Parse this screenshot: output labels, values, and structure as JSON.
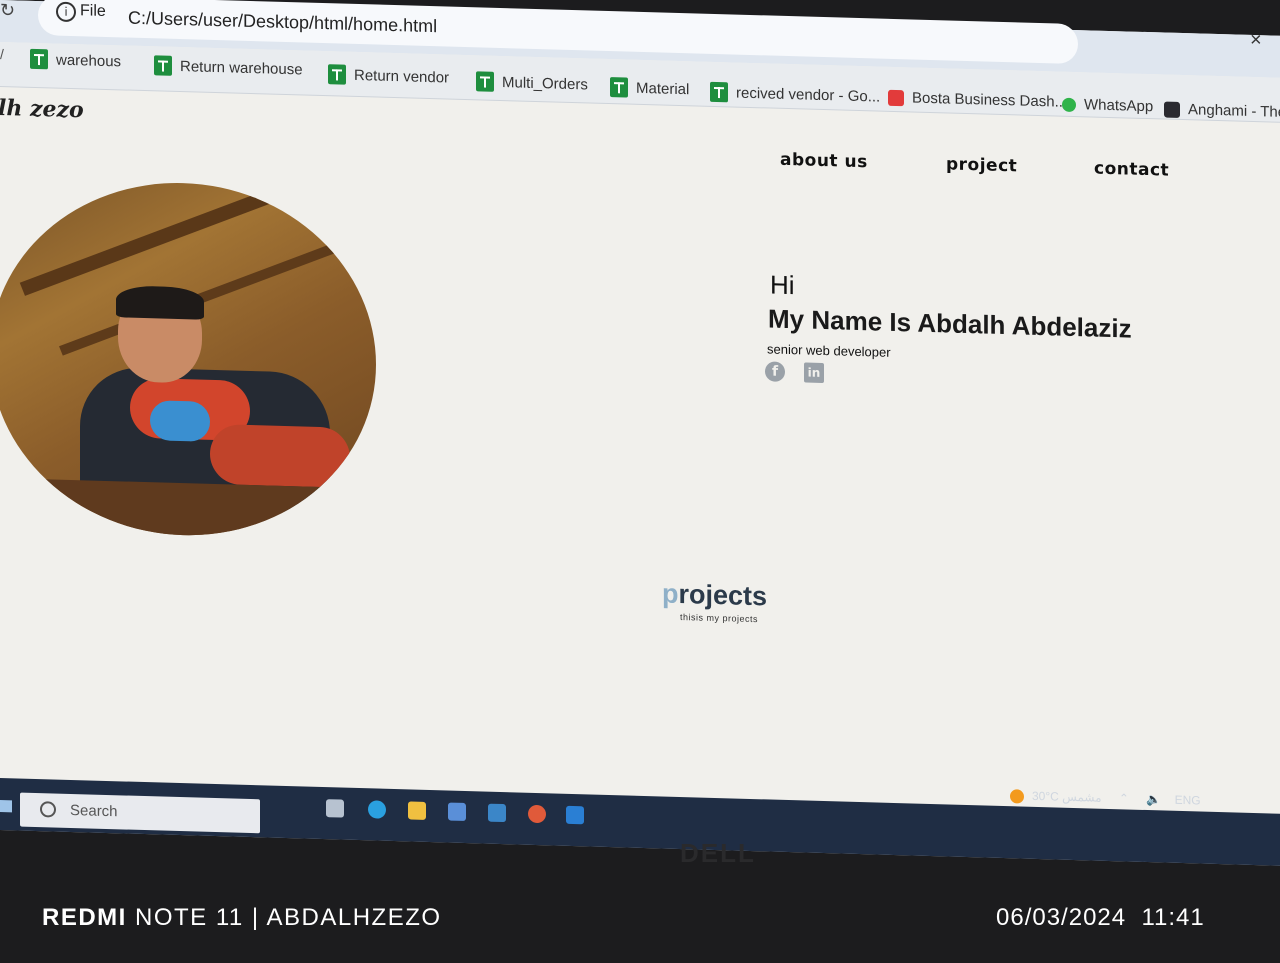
{
  "browser": {
    "file_label": "File",
    "url": "C:/Users/user/Desktop/html/home.html"
  },
  "bookmarks": [
    {
      "label": "warehous",
      "icon": "sheets-icon"
    },
    {
      "label": "Return warehouse",
      "icon": "sheets-icon"
    },
    {
      "label": "Return vendor",
      "icon": "sheets-icon"
    },
    {
      "label": "Multi_Orders",
      "icon": "sheets-icon"
    },
    {
      "label": "Material",
      "icon": "sheets-icon"
    },
    {
      "label": "recived vendor - Go...",
      "icon": "sheets-icon"
    },
    {
      "label": "Bosta Business Dash...",
      "icon": "bosta-icon"
    },
    {
      "label": "WhatsApp",
      "icon": "whatsapp-icon"
    },
    {
      "label": "Anghami - The w",
      "icon": "anghami-icon"
    }
  ],
  "page": {
    "logo": "lh zezo",
    "nav": [
      "about us",
      "project",
      "contact"
    ],
    "hero": {
      "greeting": "Hi",
      "name": "My Name Is Abdalh Abdelaziz",
      "role": "senior web developer"
    },
    "projects": {
      "title_first": "p",
      "title_rest": "rojects",
      "subtitle": "thisis my projects"
    }
  },
  "taskbar": {
    "search_placeholder": "Search",
    "weather": "30°C",
    "weather_label": "مشمس",
    "lang": "ENG"
  },
  "bezel": {
    "brand": "DELL"
  },
  "watermark": {
    "brand": "REDMI",
    "model": " NOTE 11 | ABDALHZEZO",
    "date": "06/03/2024",
    "time": "11:41"
  },
  "colors": {
    "sheets_green": "#1e8e3e",
    "taskbar": "#1f2d44",
    "page_bg": "#f1f0ec"
  }
}
